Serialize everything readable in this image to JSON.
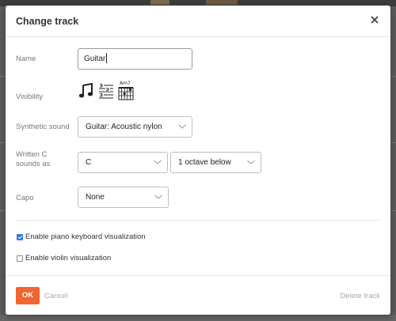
{
  "dialog": {
    "title": "Change track",
    "close_icon": "close-icon"
  },
  "name": {
    "label": "Name",
    "value": "Guitar"
  },
  "visibility": {
    "label": "Visibility",
    "icons": [
      "standard-notation-icon",
      "tablature-icon",
      "chord-diagram-icon"
    ],
    "chord_symbol": "Am7"
  },
  "synthetic_sound": {
    "label": "Synthetic sound",
    "value": "Guitar: Acoustic nylon"
  },
  "transposition": {
    "label_line1": "Written C",
    "label_line2": "sounds as",
    "note_value": "C",
    "octave_value": "1 octave below"
  },
  "capo": {
    "label": "Capo",
    "value": "None"
  },
  "options": {
    "piano_label": "Enable piano keyboard visualization",
    "piano_checked": true,
    "violin_label": "Enable violin visualization",
    "violin_checked": false
  },
  "footer": {
    "ok_label": "OK",
    "cancel_label": "Cancel",
    "delete_label": "Delete track"
  },
  "colors": {
    "accent": "#f26430",
    "checkbox": "#2f7be6"
  }
}
